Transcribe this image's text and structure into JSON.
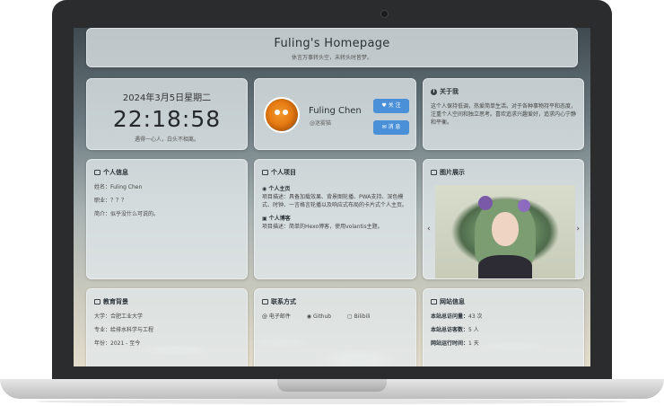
{
  "header": {
    "title": "Fuling's Homepage",
    "subtitle": "休言万事转头空，未转头时皆梦。"
  },
  "clock": {
    "date": "2024年3月5日星期二",
    "time": "22:18:58",
    "quote": "遇得一心人，白头不相离。"
  },
  "profile": {
    "name": "Fuling Chen",
    "tag": "@迷雾猫",
    "follow_label": "关 注",
    "message_label": "消 息"
  },
  "about": {
    "title": "关于我",
    "text": "这个人保持低调，热爱简单生活。对于各种事物持平和态度，注重个人空间和独立思考。喜欢追求兴趣爱好，追求内心宁静和平衡。"
  },
  "info": {
    "title": "个人信息",
    "rows": [
      "姓名：Fuling Chen",
      "职业：？？？",
      "简介：似乎没什么可说的。"
    ]
  },
  "projects": {
    "title": "个人项目",
    "items": [
      {
        "name": "个人主页",
        "desc": "项目描述：具备加载效果、背景图轮播、PWA支持、深色模式、时钟、一言格言轮播以及响应式布局的卡片式个人主页。"
      },
      {
        "name": "个人博客",
        "desc": "项目描述：简单的Hexo博客，使用volantis主题。"
      }
    ]
  },
  "gallery": {
    "title": "图片展示",
    "prev": "‹",
    "next": "›"
  },
  "education": {
    "title": "教育背景",
    "rows": [
      "大学：合肥工业大学",
      "专业：给排水科学与工程",
      "年份：2021 - 至今"
    ]
  },
  "contact": {
    "title": "联系方式",
    "links": [
      "电子邮件",
      "Github",
      "Bilibili"
    ]
  },
  "site": {
    "title": "网站信息",
    "rows": [
      {
        "k": "本站总访问量：",
        "v": "43 次"
      },
      {
        "k": "本站总访客数：",
        "v": "5 人"
      },
      {
        "k": "网站运行时间：",
        "v": "1 天"
      }
    ]
  },
  "colors": {
    "accent": "#4a90d9"
  }
}
